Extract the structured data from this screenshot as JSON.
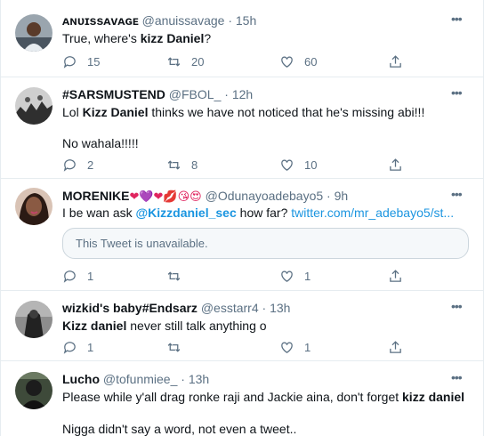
{
  "tweets": [
    {
      "name": "ᴀɴᴜɪssᴀᴠᴀɢᴇ",
      "handle": "@anuissavage",
      "sep": "·",
      "time": "15h",
      "text_parts": [
        {
          "t": "True, where's ",
          "b": false
        },
        {
          "t": "kizz Daniel",
          "b": true
        },
        {
          "t": "?",
          "b": false
        }
      ],
      "replies": "15",
      "retweets": "20",
      "likes": "60"
    },
    {
      "name": "#SARSMUSTEND",
      "handle": "@FBOL_",
      "sep": "·",
      "time": "12h",
      "text_parts": [
        {
          "t": "Lol ",
          "b": false
        },
        {
          "t": "Kizz Daniel",
          "b": true
        },
        {
          "t": " thinks we have not noticed that he's missing abi!!!",
          "b": false
        }
      ],
      "text2": "No wahala!!!!!",
      "replies": "2",
      "retweets": "8",
      "likes": "10"
    },
    {
      "name": "MORENIKE",
      "name_emojis": "❤💜❤💋😘😍",
      "handle": "@Odunayoadebayo5",
      "sep": "·",
      "time": "9h",
      "text_prefix": "I be wan ask ",
      "mention": "@Kizzdaniel_sec",
      "text_middle": " how far? ",
      "url": "twitter.com/mr_adebayo5/st...",
      "quoted_text": "This Tweet is unavailable.",
      "replies": "1",
      "retweets": "",
      "likes": "1"
    },
    {
      "name": "wizkid's baby#Endsarz",
      "handle": "@esstarr4",
      "sep": "·",
      "time": "13h",
      "text_parts": [
        {
          "t": "Kizz daniel",
          "b": true
        },
        {
          "t": " never still talk anything o",
          "b": false
        }
      ],
      "replies": "1",
      "retweets": "",
      "likes": "1"
    },
    {
      "name": "Lucho",
      "handle": "@tofunmiee_",
      "sep": "·",
      "time": "13h",
      "text_parts": [
        {
          "t": "Please while y'all drag ronke raji and Jackie aina, don't forget ",
          "b": false
        },
        {
          "t": "kizz daniel",
          "b": true
        },
        {
          "t": "..",
          "b": false
        }
      ],
      "text2": "Nigga didn't say a word, not even a tweet.."
    }
  ],
  "icons": {
    "reply": "reply-icon",
    "retweet": "retweet-icon",
    "like": "heart-icon",
    "share": "share-icon",
    "more": "more-icon"
  },
  "colors": {
    "text": "#0f1419",
    "muted": "#5b7083",
    "link": "#1b95e0",
    "border": "#e6ecf0"
  }
}
